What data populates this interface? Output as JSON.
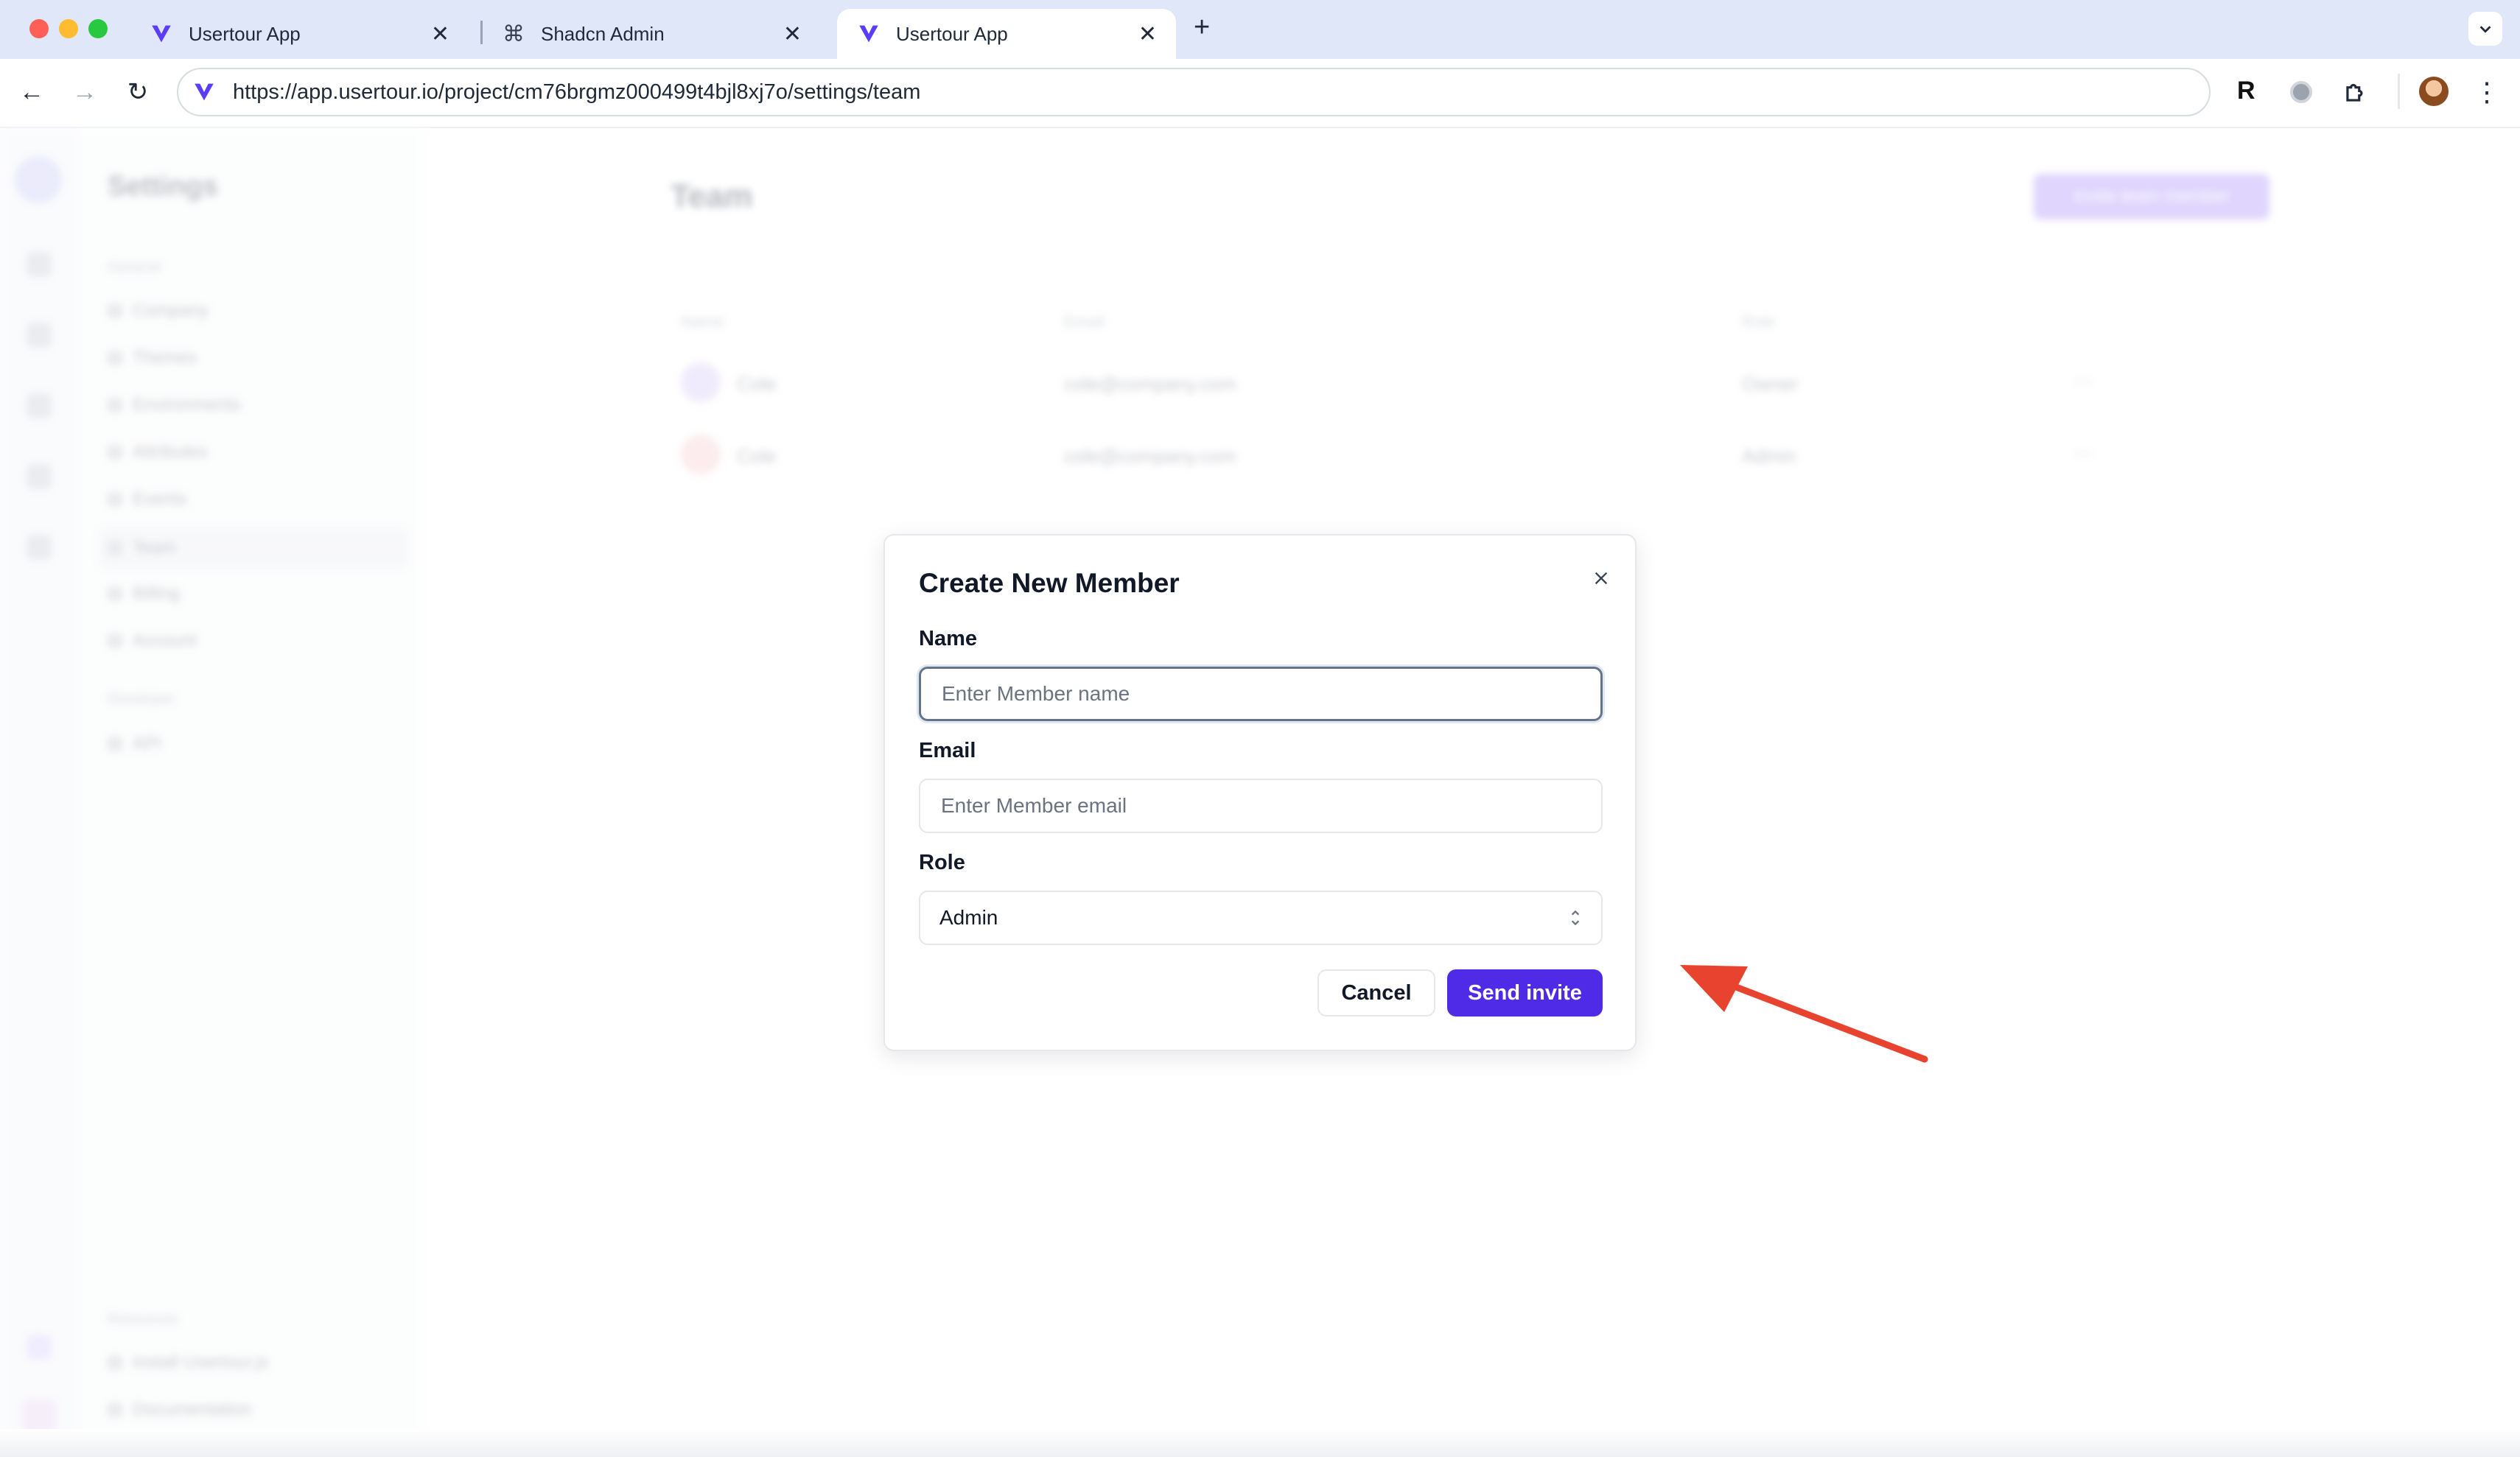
{
  "browser": {
    "tabs": [
      {
        "title": "Usertour App",
        "icon": "usertour-logo-icon",
        "active": false
      },
      {
        "title": "Shadcn Admin",
        "icon": "command-icon",
        "active": false
      },
      {
        "title": "Usertour App",
        "icon": "usertour-logo-icon",
        "active": true
      }
    ],
    "url": "https://app.usertour.io/project/cm76brgmz000499t4bjl8xj7o/settings/team",
    "colors": {
      "tabbar": "#dfe7f8",
      "accent": "#4f2be8"
    }
  },
  "background_app": {
    "sidebar_title": "Settings",
    "sidebar_group_1": "General",
    "sidebar_items": [
      "Company",
      "Themes",
      "Environments",
      "Attributes",
      "Events",
      "Team",
      "Billing",
      "Account"
    ],
    "sidebar_group_2": "Developer",
    "sidebar_items_2": [
      "API"
    ],
    "sidebar_group_3": "Resources",
    "sidebar_items_3": [
      "Install Usertour.js",
      "Documentation"
    ],
    "page_title": "Team",
    "invite_button": "Invite team member",
    "table_headers": [
      "Name",
      "Email",
      "Role"
    ],
    "table_rows": [
      {
        "name": "Cole",
        "email": "cole@company.com",
        "role": "Owner"
      },
      {
        "name": "Cole",
        "email": "cole@company.com",
        "role": "Admin"
      }
    ]
  },
  "modal": {
    "title": "Create New Member",
    "name_label": "Name",
    "name_placeholder": "Enter Member name",
    "email_label": "Email",
    "email_placeholder": "Enter Member email",
    "role_label": "Role",
    "role_value": "Admin",
    "cancel_label": "Cancel",
    "send_label": "Send invite"
  }
}
